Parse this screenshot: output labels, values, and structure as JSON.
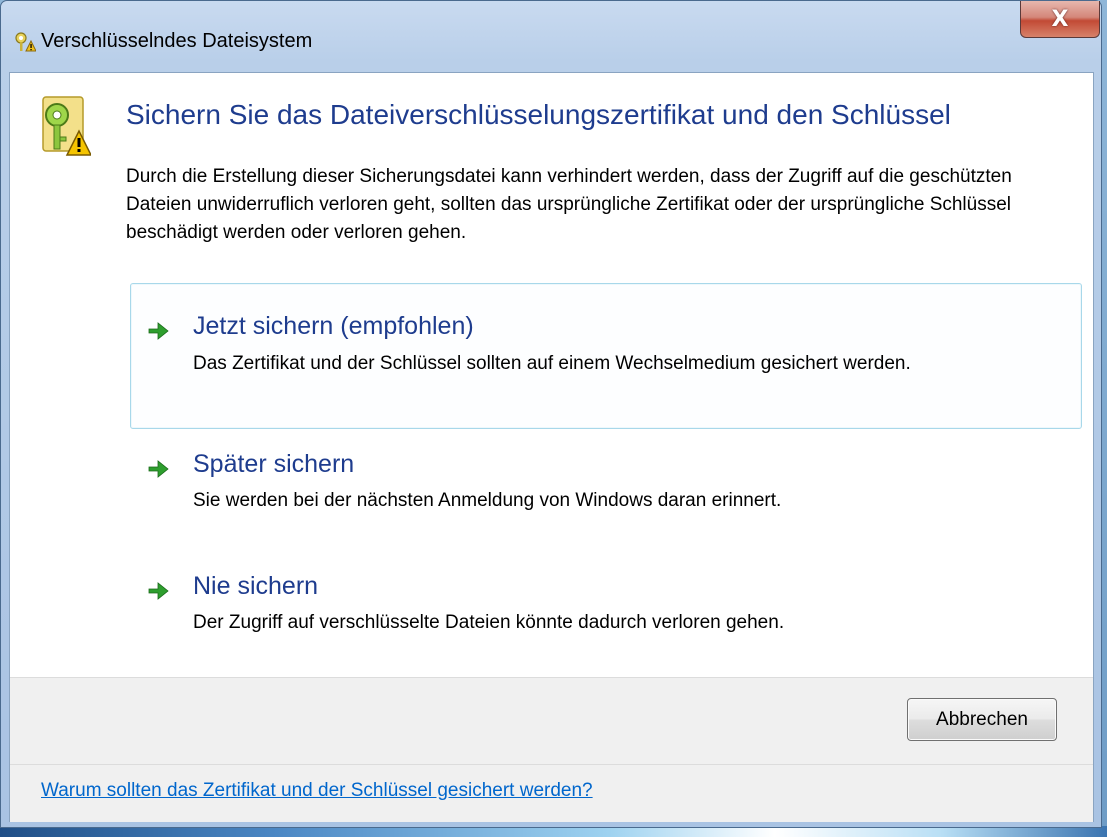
{
  "window": {
    "title": "Verschlüsselndes Dateisystem",
    "close_label": "X"
  },
  "main": {
    "heading": "Sichern Sie das Dateiverschlüsselungszertifikat und den Schlüssel",
    "description": "Durch die Erstellung dieser Sicherungsdatei kann verhindert werden, dass der Zugriff auf die geschützten Dateien unwiderruflich verloren geht, sollten das ursprüngliche Zertifikat oder der ursprüngliche Schlüssel beschädigt werden oder verloren gehen.",
    "options": [
      {
        "title": "Jetzt sichern (empfohlen)",
        "description": "Das Zertifikat und der Schlüssel sollten auf einem Wechselmedium gesichert werden.",
        "selected": true
      },
      {
        "title": "Später sichern",
        "description": "Sie werden bei der nächsten Anmeldung von Windows daran erinnert.",
        "selected": false
      },
      {
        "title": "Nie sichern",
        "description": "Der Zugriff auf verschlüsselte Dateien könnte dadurch verloren gehen.",
        "selected": false
      }
    ]
  },
  "footer": {
    "cancel_label": "Abbrechen",
    "help_link": "Warum sollten das Zertifikat und der Schlüssel gesichert werden?"
  },
  "icons": {
    "title_icon": "key-warning-icon",
    "header_icon": "key-warning-icon",
    "option_icon": "green-arrow-icon"
  },
  "colors": {
    "heading": "#1e3c8e",
    "link": "#0066cc",
    "arrow": "#2e9e2e",
    "selection_border": "#a8d8ea"
  }
}
